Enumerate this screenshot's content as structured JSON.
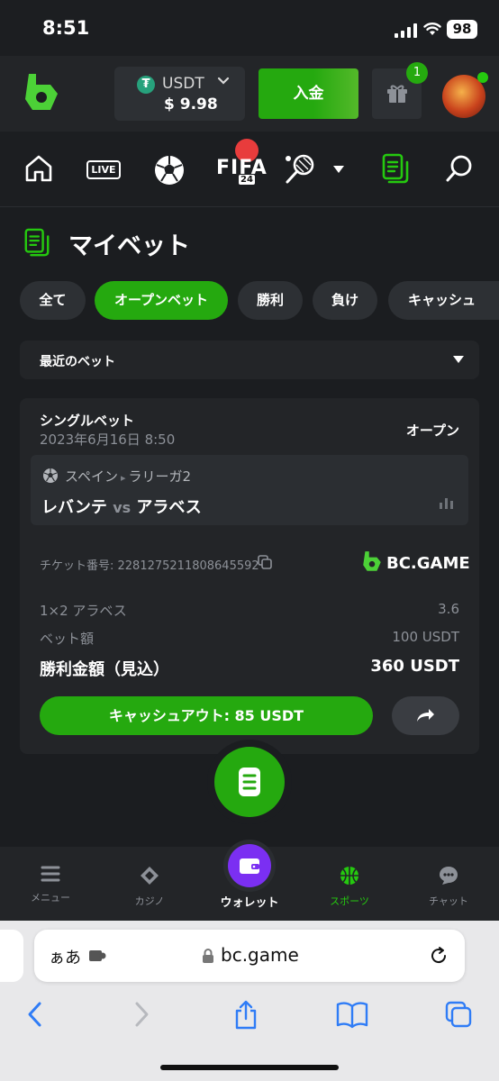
{
  "status_bar": {
    "time": "8:51",
    "battery": "98"
  },
  "header": {
    "currency": "USDT",
    "currency_symbol": "₮",
    "balance": "$ 9.98",
    "deposit_label": "入金",
    "gift_badge": "1"
  },
  "nav_icons": [
    "home-icon",
    "live-icon",
    "soccer-icon",
    "fifa-icon",
    "tennis-icon",
    "mybets-icon",
    "search-icon"
  ],
  "nav": {
    "live_label": "LIVE",
    "fifa_label": "FIFA",
    "fifa_sub": "24"
  },
  "page": {
    "title": "マイベット"
  },
  "filters": [
    {
      "label": "全て",
      "active": false
    },
    {
      "label": "オープンベット",
      "active": true
    },
    {
      "label": "勝利",
      "active": false
    },
    {
      "label": "負け",
      "active": false
    },
    {
      "label": "キャッシュ",
      "active": false
    }
  ],
  "sort_dropdown": {
    "selected": "最近のベット"
  },
  "bet": {
    "type": "シングルベット",
    "date": "2023年6月16日 8:50",
    "status": "オープン",
    "league_country": "スペイン",
    "league_name": "ラリーガ2",
    "home_team": "レバンテ",
    "vs": "vs",
    "away_team": "アラベス",
    "ticket": "チケット番号: 2281275211808645592",
    "brand": "BC.GAME",
    "market_label": "1×2 アラベス",
    "odds": "3.6",
    "stake_label": "ベット額",
    "stake": "100 USDT",
    "payout_label": "勝利金額（見込）",
    "payout": "360 USDT",
    "cashout_label": "キャッシュアウト: 85 USDT"
  },
  "tabbar": {
    "menu": "メニュー",
    "casino": "カジノ",
    "wallet": "ウォレット",
    "sports": "スポーツ",
    "chat": "チャット"
  },
  "browser": {
    "aa": "ぁあ",
    "url": "bc.game"
  },
  "colors": {
    "accent": "#25a90f",
    "wallet": "#7b2ff2",
    "bg": "#1b1d20",
    "card": "#232528"
  }
}
